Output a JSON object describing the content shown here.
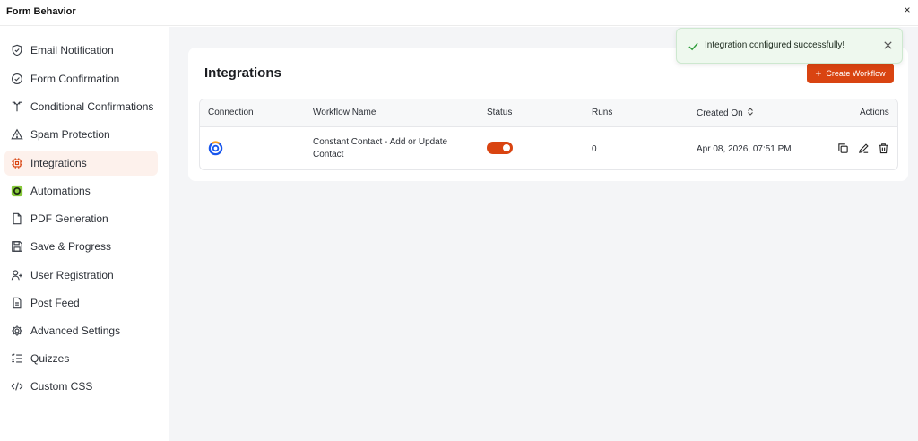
{
  "window": {
    "title": "Form Behavior",
    "close_glyph": "×"
  },
  "sidebar": {
    "items": [
      {
        "label": "Email Notification",
        "icon": "shield-check-icon"
      },
      {
        "label": "Form Confirmation",
        "icon": "check-circle-icon"
      },
      {
        "label": "Conditional Confirmations",
        "icon": "branch-icon"
      },
      {
        "label": "Spam Protection",
        "icon": "warning-triangle-icon"
      },
      {
        "label": "Integrations",
        "icon": "integration-chip-icon",
        "active": true
      },
      {
        "label": "Automations",
        "icon": "automations-icon"
      },
      {
        "label": "PDF Generation",
        "icon": "document-icon"
      },
      {
        "label": "Save & Progress",
        "icon": "save-icon"
      },
      {
        "label": "User Registration",
        "icon": "user-plus-icon"
      },
      {
        "label": "Post Feed",
        "icon": "post-feed-icon"
      },
      {
        "label": "Advanced Settings",
        "icon": "gear-icon"
      },
      {
        "label": "Quizzes",
        "icon": "quiz-list-icon"
      },
      {
        "label": "Custom CSS",
        "icon": "code-icon"
      }
    ]
  },
  "main": {
    "title": "Integrations",
    "create_button": {
      "plus": "+",
      "label": "Create Workflow"
    },
    "table": {
      "columns": {
        "connection": "Connection",
        "workflow_name": "Workflow Name",
        "status": "Status",
        "runs": "Runs",
        "created_on": "Created On",
        "actions": "Actions"
      },
      "rows": [
        {
          "connection_icon": "constant-contact-logo-icon",
          "workflow_name": "Constant Contact - Add or Update Contact",
          "status_on": true,
          "runs": "0",
          "created_on": "Apr 08, 2026, 07:51 PM"
        }
      ]
    }
  },
  "toast": {
    "message": "Integration configured successfully!"
  },
  "colors": {
    "accent": "#d94411",
    "active_nav_bg": "#fdf1ec",
    "toast_bg": "#eef8ee",
    "toast_check": "#2e9d3a",
    "main_bg": "#f4f5f7"
  }
}
